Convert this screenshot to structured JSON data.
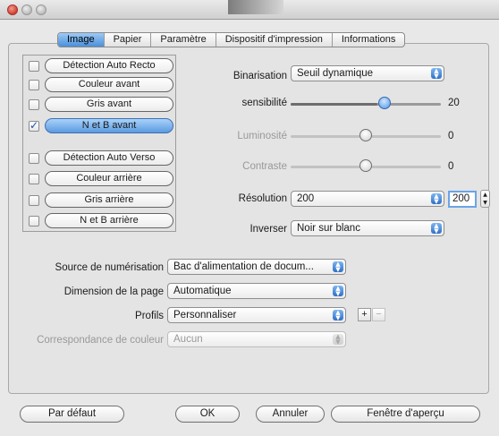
{
  "tabs": [
    "Image",
    "Papier",
    "Paramètre",
    "Dispositif d'impression",
    "Informations"
  ],
  "active_tab": "Image",
  "image_options": [
    {
      "label": "Détection Auto Recto",
      "checked": false
    },
    {
      "label": "Couleur avant",
      "checked": false
    },
    {
      "label": "Gris avant",
      "checked": false
    },
    {
      "label": "N et B avant",
      "checked": true
    },
    {
      "label": "Détection Auto Verso",
      "checked": false
    },
    {
      "label": "Couleur arrière",
      "checked": false
    },
    {
      "label": "Gris arrière",
      "checked": false
    },
    {
      "label": "N et B arrière",
      "checked": false
    }
  ],
  "settings": {
    "binarisation": {
      "label": "Binarisation",
      "value": "Seuil dynamique"
    },
    "sensibilite": {
      "label": "sensibilité",
      "value": "20",
      "level": 0.58
    },
    "luminosite": {
      "label": "Luminosité",
      "value": "0",
      "level": 0.45
    },
    "contraste": {
      "label": "Contraste",
      "value": "0",
      "level": 0.45
    },
    "resolution": {
      "label": "Résolution",
      "value": "200",
      "field": "200"
    },
    "inverser": {
      "label": "Inverser",
      "value": "Noir sur blanc"
    }
  },
  "scan": {
    "source": {
      "label": "Source de numérisation",
      "value": "Bac d'alimentation de docum..."
    },
    "dimension": {
      "label": "Dimension de la page",
      "value": "Automatique"
    },
    "profils": {
      "label": "Profils",
      "value": "Personnaliser",
      "add": "+",
      "remove": "−"
    },
    "couleur": {
      "label": "Correspondance de couleur",
      "value": "Aucun"
    }
  },
  "buttons": {
    "default": "Par défaut",
    "ok": "OK",
    "cancel": "Annuler",
    "preview": "Fenêtre d'aperçu"
  },
  "colors": {
    "accent": "#4a8fd9",
    "disabled": "#999999"
  }
}
